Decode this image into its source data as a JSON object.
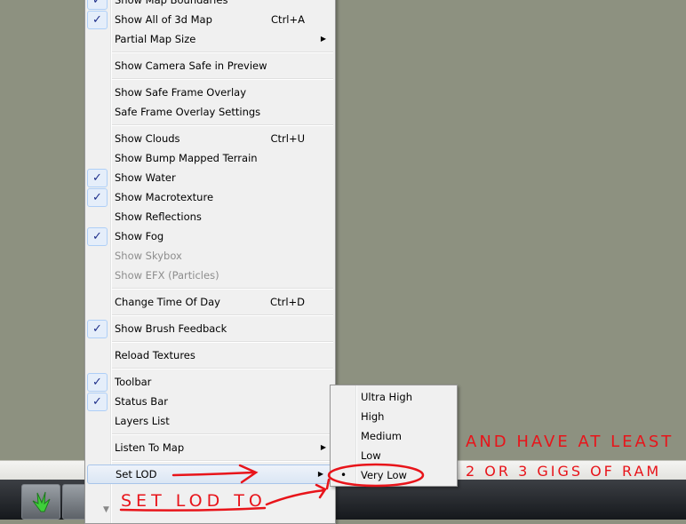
{
  "view_menu": {
    "items": [
      {
        "label": "Show Map Boundaries",
        "checked": true
      },
      {
        "label": "Show All of 3d Map",
        "shortcut": "Ctrl+A",
        "checked": true
      },
      {
        "label": "Partial Map Size",
        "submenu": true
      },
      {
        "separator": true
      },
      {
        "label": "Show Camera Safe in Preview"
      },
      {
        "separator": true
      },
      {
        "label": "Show Safe Frame Overlay"
      },
      {
        "label": "Safe Frame Overlay Settings"
      },
      {
        "separator": true
      },
      {
        "label": "Show Clouds",
        "shortcut": "Ctrl+U"
      },
      {
        "label": "Show Bump Mapped Terrain"
      },
      {
        "label": "Show Water",
        "checked": true
      },
      {
        "label": "Show Macrotexture",
        "checked": true
      },
      {
        "label": "Show Reflections"
      },
      {
        "label": "Show Fog",
        "checked": true
      },
      {
        "label": "Show Skybox",
        "disabled": true
      },
      {
        "label": "Show EFX (Particles)",
        "disabled": true
      },
      {
        "separator": true
      },
      {
        "label": "Change Time Of Day",
        "shortcut": "Ctrl+D"
      },
      {
        "separator": true
      },
      {
        "label": "Show Brush Feedback",
        "checked": true
      },
      {
        "separator": true
      },
      {
        "label": "Reload Textures"
      },
      {
        "separator": true
      },
      {
        "label": "Toolbar",
        "checked": true
      },
      {
        "label": "Status Bar",
        "checked": true
      },
      {
        "label": "Layers List"
      },
      {
        "separator": true
      },
      {
        "label": "Listen To Map",
        "submenu": true
      },
      {
        "separator": true
      },
      {
        "label": "Set LOD",
        "submenu": true,
        "highlighted": true
      }
    ],
    "more_arrow": "▼"
  },
  "lod_submenu": {
    "items": [
      {
        "label": "Ultra High"
      },
      {
        "label": "High"
      },
      {
        "label": "Medium"
      },
      {
        "label": "Low"
      },
      {
        "label": "Very Low",
        "selected": true
      }
    ]
  },
  "annotations": {
    "color": "#e8141a",
    "set_lod_to": "SET LOD TO",
    "line1": "AND HAVE AT LEAST",
    "line2": "2 OR 3 GIGS OF RAM"
  },
  "icons": {
    "check": "✓",
    "submenu_arrow": "▶",
    "radio_bullet": "•"
  }
}
